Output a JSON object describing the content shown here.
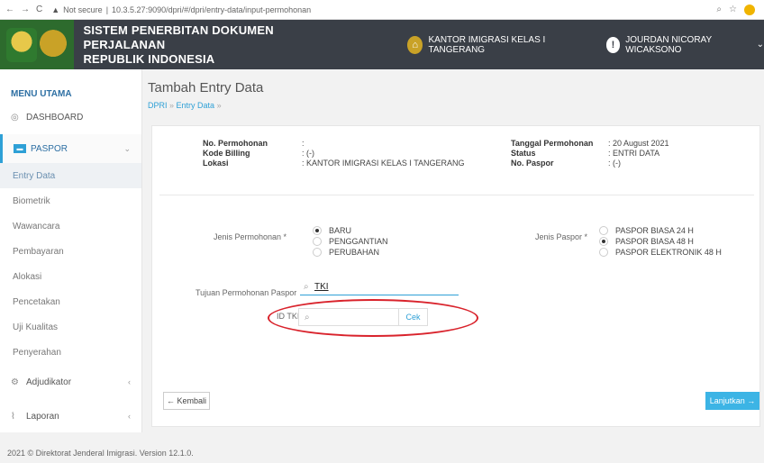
{
  "browser": {
    "nav_icons": [
      "back-icon",
      "forward-icon",
      "reload-icon"
    ],
    "security": "Not secure",
    "url": "10.3.5.27:9090/dpri/#/dpri/entry-data/input-permohonan"
  },
  "header": {
    "title_line1": "SISTEM PENERBITAN DOKUMEN PERJALANAN",
    "title_line2": "REPUBLIK INDONESIA",
    "office": "KANTOR IMIGRASI KELAS I TANGERANG",
    "user": "JOURDAN NICORAY WICAKSONO"
  },
  "sidebar": {
    "heading": "MENU UTAMA",
    "dashboard": "DASHBOARD",
    "paspor": "PASPOR",
    "sub_items": [
      "Entry Data",
      "Biometrik",
      "Wawancara",
      "Pembayaran",
      "Alokasi",
      "Pencetakan",
      "Uji Kualitas",
      "Penyerahan"
    ],
    "adjudikator": "Adjudikator",
    "laporan": "Laporan"
  },
  "main": {
    "title": "Tambah Entry Data",
    "breadcrumb_root": "DPRI",
    "breadcrumb_current": "Entry Data",
    "info_left": {
      "no_permohonan_label": "No. Permohonan",
      "no_permohonan_value": ":",
      "kode_billing_label": "Kode Billing",
      "kode_billing_value": ": (-)",
      "lokasi_label": "Lokasi",
      "lokasi_value": ": KANTOR IMIGRASI KELAS I TANGERANG"
    },
    "info_right": {
      "tanggal_label": "Tanggal Permohonan",
      "tanggal_value": ": 20 August 2021",
      "status_label": "Status",
      "status_value": ": ENTRI DATA",
      "paspor_label": "No. Paspor",
      "paspor_value": ": (-)"
    },
    "jenis_permohonan_label": "Jenis Permohonan *",
    "jenis_permohonan_options": [
      "BARU",
      "PENGGANTIAN",
      "PERUBAHAN"
    ],
    "jenis_paspor_label": "Jenis Paspor *",
    "jenis_paspor_options": [
      "PASPOR BIASA 24 H",
      "PASPOR BIASA 48 H",
      "PASPOR ELEKTRONIK 48 H"
    ],
    "tujuan_label": "Tujuan Permohonan Paspor",
    "tujuan_value": "TKI",
    "id_tki_label": "ID TKI",
    "id_tki_placeholder": "",
    "cek_label": "Cek",
    "back_label": "← Kembali",
    "next_label": "Lanjutkan →"
  },
  "footer": "2021 © Direktorat Jenderal Imigrasi. Version 12.1.0."
}
